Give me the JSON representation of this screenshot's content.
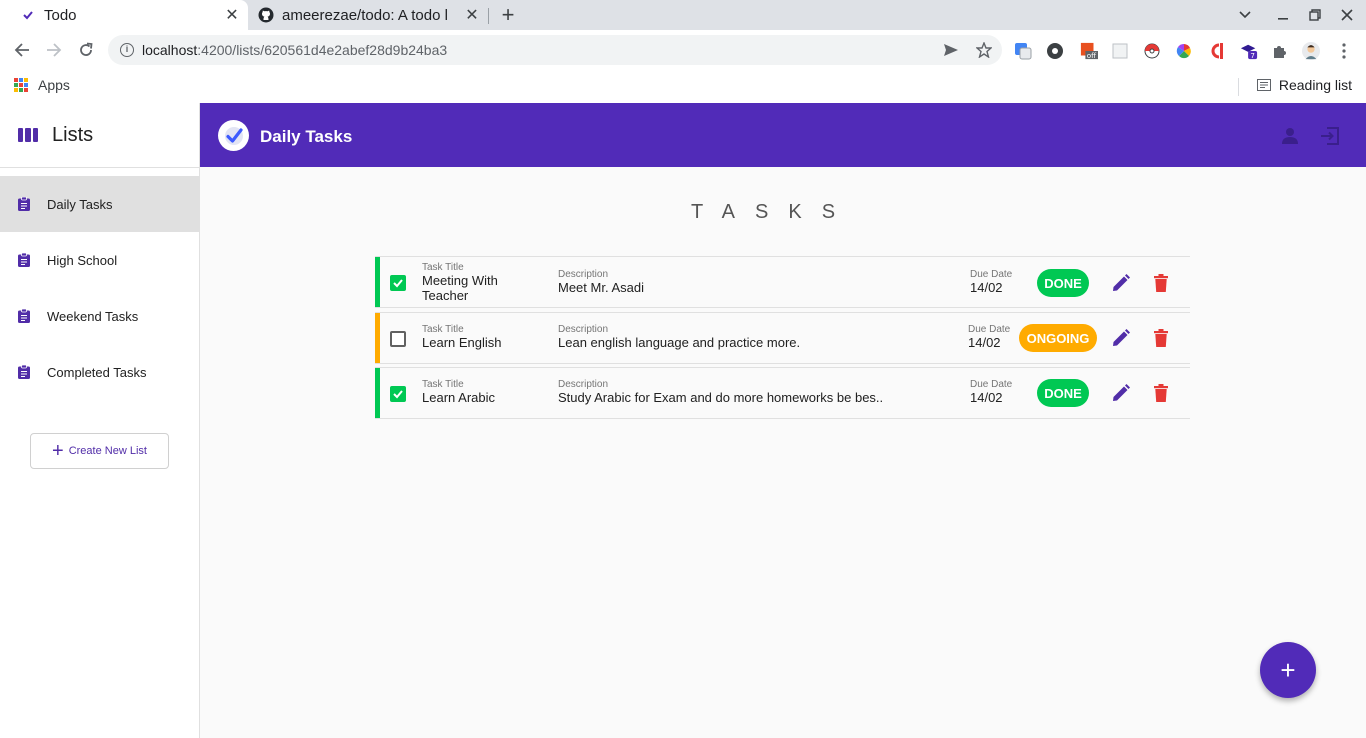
{
  "browser": {
    "tabs": [
      {
        "title": "Todo",
        "active": true
      },
      {
        "title": "ameerezae/todo: A todo l"
      }
    ],
    "url": {
      "host": "localhost",
      "path": ":4200/lists/620561d4e2abef28d9b24ba3"
    },
    "bookmarks": {
      "apps_label": "Apps",
      "reading_list_label": "Reading list"
    },
    "extension_badge": "7"
  },
  "sidebar": {
    "title": "Lists",
    "items": [
      {
        "label": "Daily Tasks",
        "active": true
      },
      {
        "label": "High School"
      },
      {
        "label": "Weekend Tasks"
      },
      {
        "label": "Completed Tasks"
      }
    ],
    "create_label": "Create New List"
  },
  "header": {
    "title": "Daily Tasks"
  },
  "main": {
    "section_title": "TASKS",
    "labels": {
      "title": "Task Title",
      "description": "Description",
      "due": "Due Date"
    },
    "tasks": [
      {
        "title_line1": "Meeting With",
        "title_line2": "Teacher",
        "description": "Meet Mr. Asadi",
        "due": "14/02",
        "status": "DONE",
        "done": true
      },
      {
        "title_line1": "Learn English",
        "title_line2": "",
        "description": "Lean english language and practice more.",
        "due": "14/02",
        "status": "ONGOING",
        "done": false
      },
      {
        "title_line1": "Learn Arabic",
        "title_line2": "",
        "description": "Study Arabic for Exam and do more homeworks be bes..",
        "due": "14/02",
        "status": "DONE",
        "done": true
      }
    ]
  },
  "colors": {
    "primary": "#512bb8",
    "done": "#00c853",
    "ongoing": "#ffab00",
    "delete": "#e53935"
  },
  "icons": [
    "list-columns-icon",
    "clipboard-icon",
    "check-logo-icon",
    "person-icon",
    "logout-icon",
    "edit-icon",
    "delete-icon",
    "add-icon"
  ]
}
